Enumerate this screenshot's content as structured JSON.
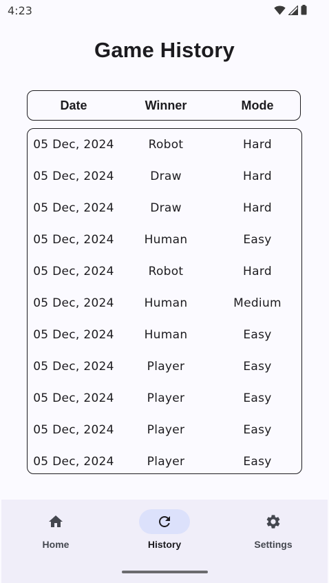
{
  "status_bar": {
    "time": "4:23"
  },
  "page": {
    "title": "Game History"
  },
  "table": {
    "headers": {
      "date": "Date",
      "winner": "Winner",
      "mode": "Mode"
    },
    "rows": [
      {
        "date": "05 Dec, 2024",
        "winner": "Robot",
        "mode": "Hard"
      },
      {
        "date": "05 Dec, 2024",
        "winner": "Draw",
        "mode": "Hard"
      },
      {
        "date": "05 Dec, 2024",
        "winner": "Draw",
        "mode": "Hard"
      },
      {
        "date": "05 Dec, 2024",
        "winner": "Human",
        "mode": "Easy"
      },
      {
        "date": "05 Dec, 2024",
        "winner": "Robot",
        "mode": "Hard"
      },
      {
        "date": "05 Dec, 2024",
        "winner": "Human",
        "mode": "Medium"
      },
      {
        "date": "05 Dec, 2024",
        "winner": "Human",
        "mode": "Easy"
      },
      {
        "date": "05 Dec, 2024",
        "winner": "Player",
        "mode": "Easy"
      },
      {
        "date": "05 Dec, 2024",
        "winner": "Player",
        "mode": "Easy"
      },
      {
        "date": "05 Dec, 2024",
        "winner": "Player",
        "mode": "Easy"
      },
      {
        "date": "05 Dec, 2024",
        "winner": "Player",
        "mode": "Easy"
      }
    ]
  },
  "bottom_nav": {
    "items": [
      {
        "label": "Home",
        "icon": "home-icon",
        "active": false
      },
      {
        "label": "History",
        "icon": "refresh-icon",
        "active": true
      },
      {
        "label": "Settings",
        "icon": "gear-icon",
        "active": false
      }
    ]
  },
  "colors": {
    "background": "#fbfaff",
    "nav_background": "#f0eef9",
    "active_indicator": "#dce1fb",
    "text": "#1c1b1f"
  }
}
